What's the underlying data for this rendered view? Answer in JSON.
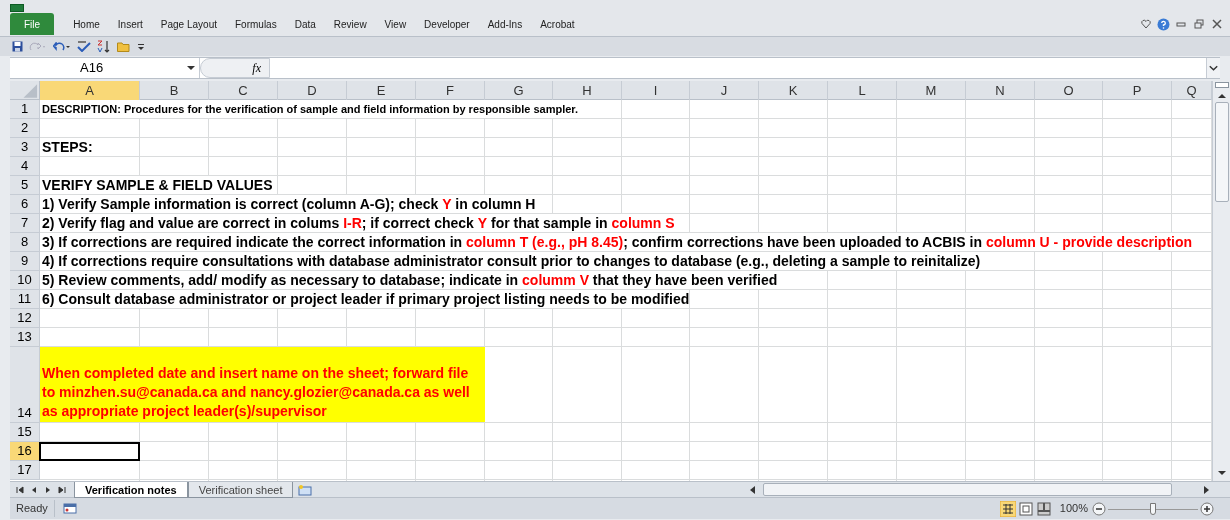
{
  "ribbon": {
    "file_tab": "File",
    "tabs": [
      "Home",
      "Insert",
      "Page Layout",
      "Formulas",
      "Data",
      "Review",
      "View",
      "Developer",
      "Add-Ins",
      "Acrobat"
    ]
  },
  "formula_bar": {
    "name_box": "A16",
    "fx": "fx"
  },
  "columns": [
    {
      "label": "A",
      "selected": true
    },
    {
      "label": "B",
      "selected": false
    },
    {
      "label": "C",
      "selected": false
    },
    {
      "label": "D",
      "selected": false
    },
    {
      "label": "E",
      "selected": false
    },
    {
      "label": "F",
      "selected": false
    },
    {
      "label": "G",
      "selected": false
    },
    {
      "label": "H",
      "selected": false
    },
    {
      "label": "I",
      "selected": false
    },
    {
      "label": "J",
      "selected": false
    },
    {
      "label": "K",
      "selected": false
    },
    {
      "label": "L",
      "selected": false
    },
    {
      "label": "M",
      "selected": false
    },
    {
      "label": "N",
      "selected": false
    },
    {
      "label": "O",
      "selected": false
    },
    {
      "label": "P",
      "selected": false
    },
    {
      "label": "Q",
      "selected": false
    }
  ],
  "rows": [
    {
      "number": "1",
      "selected": false,
      "kind": "small",
      "segments": [
        {
          "text": "DESCRIPTION: Procedures for the verification of sample and field information by responsible sampler.",
          "color": "#000000"
        }
      ]
    },
    {
      "number": "2",
      "selected": false,
      "kind": "normal",
      "segments": []
    },
    {
      "number": "3",
      "selected": false,
      "kind": "normal",
      "segments": [
        {
          "text": "STEPS:",
          "color": "#000000"
        }
      ]
    },
    {
      "number": "4",
      "selected": false,
      "kind": "normal",
      "segments": []
    },
    {
      "number": "5",
      "selected": false,
      "kind": "normal",
      "segments": [
        {
          "text": "VERIFY SAMPLE & FIELD VALUES",
          "color": "#000000"
        }
      ]
    },
    {
      "number": "6",
      "selected": false,
      "kind": "normal",
      "segments": [
        {
          "text": "1) Verify Sample information is correct (column A-G); check ",
          "color": "#000000"
        },
        {
          "text": "Y",
          "color": "#ff0000"
        },
        {
          "text": " in column H",
          "color": "#000000"
        }
      ]
    },
    {
      "number": "7",
      "selected": false,
      "kind": "normal",
      "segments": [
        {
          "text": "2) Verify flag and value are correct in colums ",
          "color": "#000000"
        },
        {
          "text": "I-R",
          "color": "#ff0000"
        },
        {
          "text": "; if correct check ",
          "color": "#000000"
        },
        {
          "text": "Y",
          "color": "#ff0000"
        },
        {
          "text": " for that sample in ",
          "color": "#000000"
        },
        {
          "text": "column S",
          "color": "#ff0000"
        }
      ]
    },
    {
      "number": "8",
      "selected": false,
      "kind": "normal",
      "segments": [
        {
          "text": "3) If corrections are required indicate the correct information in ",
          "color": "#000000"
        },
        {
          "text": "column T (e.g., pH 8.45)",
          "color": "#ff0000"
        },
        {
          "text": "; confirm corrections have been uploaded to ACBIS in ",
          "color": "#000000"
        },
        {
          "text": "column U - provide description",
          "color": "#ff0000"
        }
      ]
    },
    {
      "number": "9",
      "selected": false,
      "kind": "normal",
      "segments": [
        {
          "text": "4) If corrections require consultations with database administrator consult prior to changes to database (e.g., deleting a sample to reinitalize)",
          "color": "#000000"
        }
      ]
    },
    {
      "number": "10",
      "selected": false,
      "kind": "normal",
      "segments": [
        {
          "text": "5) Review comments, add/ modify as necessary to database; indicate in ",
          "color": "#000000"
        },
        {
          "text": "columm V",
          "color": "#ff0000"
        },
        {
          "text": " that they have been verified",
          "color": "#000000"
        }
      ]
    },
    {
      "number": "11",
      "selected": false,
      "kind": "normal",
      "segments": [
        {
          "text": "6) Consult database administrator or project leader if primary project listing needs to be modified",
          "color": "#000000"
        }
      ]
    },
    {
      "number": "12",
      "selected": false,
      "kind": "normal",
      "segments": []
    },
    {
      "number": "13",
      "selected": false,
      "kind": "normal",
      "segments": []
    },
    {
      "number": "14",
      "selected": false,
      "kind": "note",
      "segments": [
        {
          "text": "When completed date and insert name on the sheet; forward file to minzhen.su@canada.ca and nancy.glozier@canada.ca as well as appropriate project leader(s)/supervisor",
          "color": "#ff0000"
        }
      ]
    },
    {
      "number": "15",
      "selected": false,
      "kind": "normal",
      "segments": []
    },
    {
      "number": "16",
      "selected": true,
      "kind": "normal",
      "segments": []
    },
    {
      "number": "17",
      "selected": false,
      "kind": "normal",
      "segments": []
    }
  ],
  "sheet_tabs": [
    {
      "label": "Verification notes",
      "selected": true
    },
    {
      "label": "Verification sheet",
      "selected": false
    }
  ],
  "status_bar": {
    "status": "Ready",
    "zoom": "100%",
    "zoom_slider": {
      "level": 0.5
    }
  }
}
